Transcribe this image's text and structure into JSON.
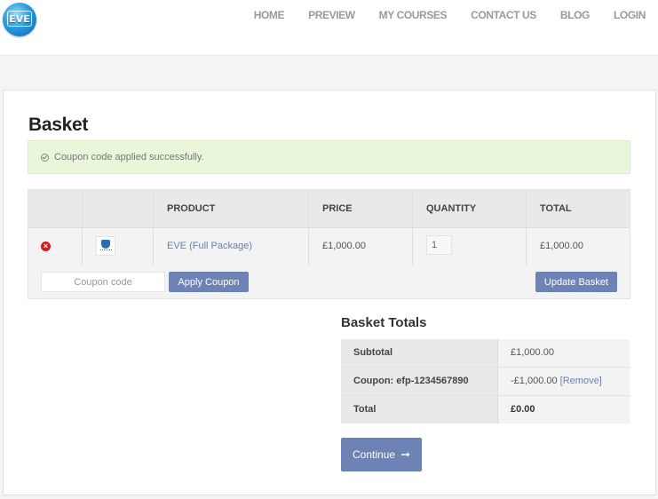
{
  "header": {
    "logo_text": "EVE",
    "nav": [
      "HOME",
      "PREVIEW",
      "MY COURSES",
      "CONTACT US",
      "BLOG",
      "LOGIN"
    ]
  },
  "page": {
    "title": "Basket",
    "notice": "Coupon code applied successfully."
  },
  "cart": {
    "columns": [
      "PRODUCT",
      "PRICE",
      "QUANTITY",
      "TOTAL"
    ],
    "items": [
      {
        "product": "EVE (Full Package)",
        "price": "£1,000.00",
        "quantity": "1",
        "total": "£1,000.00"
      }
    ],
    "coupon_placeholder": "Coupon code",
    "apply_label": "Apply Coupon",
    "update_label": "Update Basket"
  },
  "totals": {
    "title": "Basket Totals",
    "rows": [
      {
        "label": "Subtotal",
        "value": "£1,000.00"
      },
      {
        "label": "Coupon: efp-1234567890",
        "value": "-£1,000.00",
        "link": "[Remove]"
      },
      {
        "label": "Total",
        "value": "£0.00"
      }
    ],
    "continue_label": "Continue",
    "continue_arrow": "➞"
  },
  "colors": {
    "accent": "#6e83b5",
    "notice_bg": "#eaf6d9",
    "remove": "#d11d1d",
    "link": "#6a7fb0"
  }
}
